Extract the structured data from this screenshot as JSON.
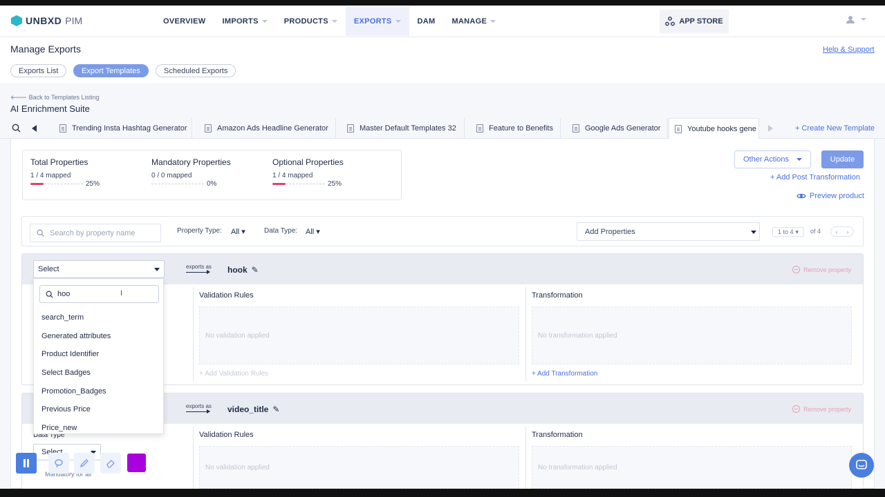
{
  "app": {
    "brand": "UNBXD",
    "brand_sub": "PIM"
  },
  "nav": {
    "items": [
      {
        "label": "OVERVIEW",
        "caret": false
      },
      {
        "label": "IMPORTS",
        "caret": true
      },
      {
        "label": "PRODUCTS",
        "caret": true
      },
      {
        "label": "EXPORTS",
        "caret": true,
        "active": true
      },
      {
        "label": "DAM",
        "caret": false
      },
      {
        "label": "MANAGE",
        "caret": true
      }
    ],
    "app_store": "APP STORE"
  },
  "page": {
    "title": "Manage Exports",
    "help": "Help & Support",
    "pills": [
      "Exports List",
      "Export Templates",
      "Scheduled Exports"
    ],
    "back": "Back to Templates Listing",
    "suite": "AI Enrichment Suite"
  },
  "tabs": {
    "items": [
      "Trending Insta Hashtag Generator",
      "Amazon Ads Headline Generator",
      "Master Default Templates 32",
      "Feature to Benefits",
      "Google Ads Generator",
      "Youtube hooks gene"
    ],
    "new_template": "+ Create New Template"
  },
  "stats": [
    {
      "title": "Total Properties",
      "mapped": "1 / 4 mapped",
      "pct_label": "25%",
      "fraction": 0.25
    },
    {
      "title": "Mandatory Properties",
      "mapped": "0 / 0 mapped",
      "pct_label": "0%",
      "fraction": 0
    },
    {
      "title": "Optional Properties",
      "mapped": "1 / 4 mapped",
      "pct_label": "25%",
      "fraction": 0.25
    }
  ],
  "actions": {
    "other": "Other Actions",
    "update": "Update",
    "post_transform": "+ Add Post Transformation",
    "preview": "Preview product"
  },
  "filters": {
    "search_placeholder": "Search by property name",
    "property_type_label": "Property Type:",
    "property_type_value": "All",
    "data_type_label": "Data Type:",
    "data_type_value": "All",
    "add_properties": "Add Properties",
    "pager_range": "1 to 4",
    "pager_of": "of 4"
  },
  "properties": [
    {
      "select": "Select",
      "exports_as": "exports as",
      "name": "hook",
      "remove": "Remove property",
      "validation_title": "Validation Rules",
      "validation_empty": "No validation applied",
      "validation_add": "+ Add Validation Rules",
      "transform_title": "Transformation",
      "transform_empty": "No transformation applied",
      "transform_add": "+ Add Transformation"
    },
    {
      "exports_as": "exports as",
      "name": "video_title",
      "remove": "Remove property",
      "data_type_label": "Data Type",
      "data_type_select": "Select",
      "mandatory": "Mandatory for all",
      "validation_title": "Validation Rules",
      "validation_empty": "No validation applied",
      "transform_title": "Transformation",
      "transform_empty": "No transformation applied"
    }
  ],
  "dropdown": {
    "query": "hoo",
    "options": [
      "search_term",
      "Generated attributes",
      "Product Identifier",
      "Select Badges",
      "Promotion_Badges",
      "Previous Price",
      "Price_new"
    ]
  },
  "colors": {
    "accent": "#4a6fd8",
    "primary_button": "#7b9be8",
    "progress": "#e0426b",
    "brand": "#2bb6c9",
    "swatch": "#aa00dd"
  }
}
